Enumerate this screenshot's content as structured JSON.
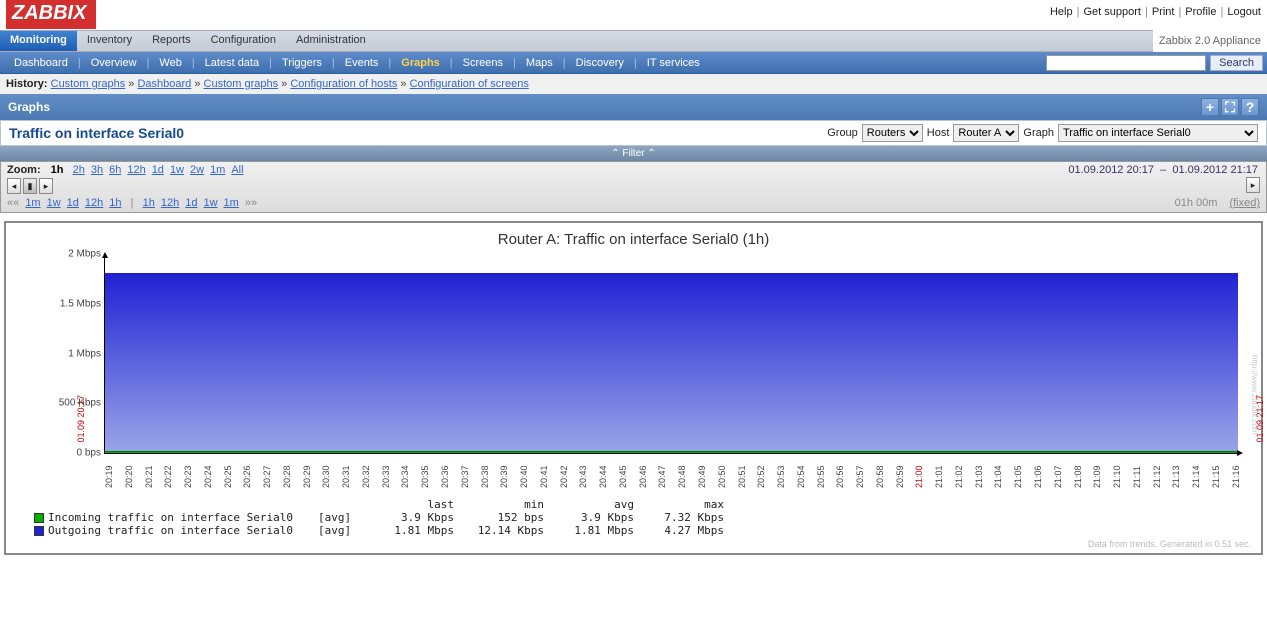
{
  "logo": "ZABBIX",
  "top_links": [
    "Help",
    "Get support",
    "Print",
    "Profile",
    "Logout"
  ],
  "appliance": "Zabbix 2.0 Appliance",
  "main_tabs": [
    "Monitoring",
    "Inventory",
    "Reports",
    "Configuration",
    "Administration"
  ],
  "active_main_tab": "Monitoring",
  "sub_tabs": [
    "Dashboard",
    "Overview",
    "Web",
    "Latest data",
    "Triggers",
    "Events",
    "Graphs",
    "Screens",
    "Maps",
    "Discovery",
    "IT services"
  ],
  "active_sub_tab": "Graphs",
  "search_placeholder": "",
  "search_button": "Search",
  "history_label": "History:",
  "history": [
    "Custom graphs",
    "Dashboard",
    "Custom graphs",
    "Configuration of hosts",
    "Configuration of screens"
  ],
  "section_title": "Graphs",
  "graph_name": "Traffic on interface Serial0",
  "selectors": {
    "group_label": "Group",
    "group": "Routers",
    "host_label": "Host",
    "host": "Router A",
    "graph_label": "Graph",
    "graph": "Traffic on interface Serial0"
  },
  "filter_label": "Filter",
  "zoom": {
    "label": "Zoom:",
    "current": "1h",
    "options": [
      "2h",
      "3h",
      "6h",
      "12h",
      "1d",
      "1w",
      "2w",
      "1m",
      "All"
    ]
  },
  "date_from": "01.09.2012 20:17",
  "date_to": "01.09.2012 21:17",
  "nav_left": [
    "1m",
    "1w",
    "1d",
    "12h",
    "1h"
  ],
  "nav_right": [
    "1h",
    "12h",
    "1d",
    "1w",
    "1m"
  ],
  "duration": "01h 00m",
  "fixed_label": "(fixed)",
  "chart_data": {
    "title": "Router A: Traffic on interface Serial0 (1h)",
    "type": "area",
    "ylabel": "",
    "ylim_bps": [
      0,
      2000000
    ],
    "y_ticks": [
      "2 Mbps",
      "1.5 Mbps",
      "1 Mbps",
      "500 Kbps",
      "0 bps"
    ],
    "x_start": "01.09 20:17",
    "x_end": "01.09 21:17",
    "x_ticks": [
      "20:19",
      "20:20",
      "20:21",
      "20:22",
      "20:23",
      "20:24",
      "20:25",
      "20:26",
      "20:27",
      "20:28",
      "20:29",
      "20:30",
      "20:31",
      "20:32",
      "20:33",
      "20:34",
      "20:35",
      "20:36",
      "20:37",
      "20:38",
      "20:39",
      "20:40",
      "20:41",
      "20:42",
      "20:43",
      "20:44",
      "20:45",
      "20:46",
      "20:47",
      "20:48",
      "20:49",
      "20:50",
      "20:51",
      "20:52",
      "20:53",
      "20:54",
      "20:55",
      "20:56",
      "20:57",
      "20:58",
      "20:59",
      "21:00",
      "21:01",
      "21:02",
      "21:03",
      "21:04",
      "21:05",
      "21:06",
      "21:07",
      "21:08",
      "21:09",
      "21:10",
      "21:11",
      "21:12",
      "21:13",
      "21:14",
      "21:15",
      "21:16"
    ],
    "x_tick_red": "21:00",
    "series": [
      {
        "name": "Incoming traffic on interface Serial0",
        "agg": "avg",
        "last": "3.9 Kbps",
        "min": "152 bps",
        "avg": "3.9 Kbps",
        "max": "7.32 Kbps",
        "color": "#00b000",
        "approx_constant_bps": 3900
      },
      {
        "name": "Outgoing traffic on interface Serial0",
        "agg": "avg",
        "last": "1.81 Mbps",
        "min": "12.14 Kbps",
        "avg": "1.81 Mbps",
        "max": "4.27 Mbps",
        "color": "#2121d4",
        "approx_constant_bps": 1810000
      }
    ],
    "legend_headers": [
      "last",
      "min",
      "avg",
      "max"
    ]
  },
  "footnote": "Data from trends. Generated in 0.51 sec.",
  "watermark": "http://www.zabbix.com"
}
